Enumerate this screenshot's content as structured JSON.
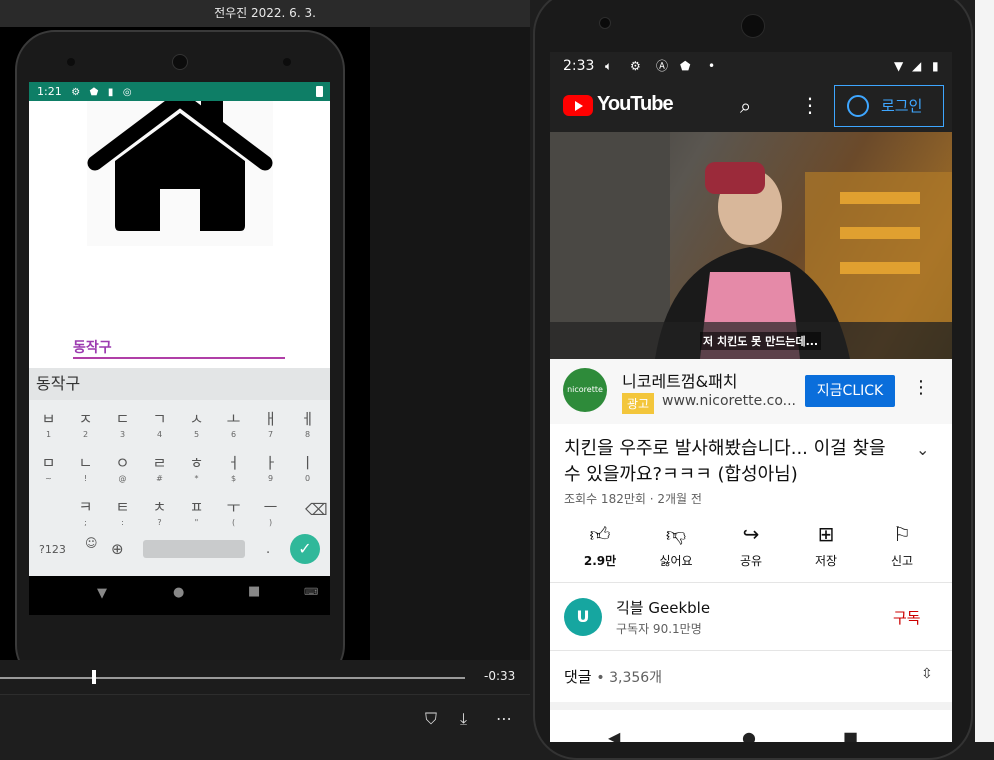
{
  "left": {
    "title": "전우진 2022. 6. 3.",
    "emulator": {
      "status_time": "1:21",
      "field_text": "동작구",
      "suggestion": "동작구",
      "keyboard": {
        "row1": [
          [
            "ㅂ",
            "1"
          ],
          [
            "ㅈ",
            "2"
          ],
          [
            "ㄷ",
            "3"
          ],
          [
            "ㄱ",
            "4"
          ],
          [
            "ㅅ",
            "5"
          ],
          [
            "ㅗ",
            "6"
          ],
          [
            "ㅐ",
            "7"
          ],
          [
            "ㅔ",
            "8"
          ]
        ],
        "row2": [
          [
            "ㅁ",
            "~"
          ],
          [
            "ㄴ",
            "!"
          ],
          [
            "ㅇ",
            "@"
          ],
          [
            "ㄹ",
            "#"
          ],
          [
            "ㅎ",
            "*"
          ],
          [
            "ㅓ",
            "$"
          ],
          [
            "ㅏ",
            "9"
          ],
          [
            "ㅣ",
            "0"
          ]
        ],
        "row3": [
          [
            "ㅋ",
            ";"
          ],
          [
            "ㅌ",
            ":"
          ],
          [
            "ㅊ",
            "?"
          ],
          [
            "ㅍ",
            "\""
          ],
          [
            "ㅜ",
            "("
          ],
          [
            "ㅡ",
            ")"
          ]
        ],
        "sym_label": "?123",
        "period": "."
      }
    },
    "player": {
      "time_remaining": "-0:33",
      "progress_fraction": 0.2
    }
  },
  "right": {
    "status_time": "2:33",
    "header": {
      "logo_text": "YouTube",
      "login_label": "로그인"
    },
    "video": {
      "subtitle": "저 치킨도 못 만드는데..."
    },
    "ad": {
      "logo_text": "nicorette",
      "title": "니코레트껌&패치",
      "badge": "광고",
      "url": "www.nicorette.co...",
      "cta": "지금CLICK"
    },
    "title": "치킨을 우주로 발사해봤습니다... 이걸 찾을 수 있을까요?ㅋㅋㅋ (합성아님)",
    "meta": "조회수 182만회 · 2개월 전",
    "actions": [
      {
        "icon": "thumb-up-icon",
        "label": "2.9만"
      },
      {
        "icon": "thumb-down-icon",
        "label": "싫어요"
      },
      {
        "icon": "share-icon",
        "label": "공유"
      },
      {
        "icon": "save-icon",
        "label": "저장"
      },
      {
        "icon": "flag-icon",
        "label": "신고"
      }
    ],
    "channel": {
      "name": "긱블 Geekble",
      "subscribers": "구독자 90.1만명",
      "subscribe_label": "구독"
    },
    "comments": {
      "label": "댓글",
      "count": "• 3,356개"
    }
  }
}
